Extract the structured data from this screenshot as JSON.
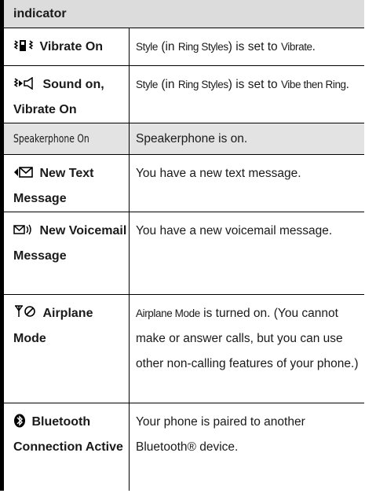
{
  "table": {
    "header": "indicator",
    "rows": [
      {
        "icon": "vibrate-icon",
        "icon_glyph": "⦚▮⦚",
        "title": "Vibrate On",
        "desc_parts": [
          {
            "t": "Style",
            "k": "c"
          },
          {
            "t": " (in ",
            "k": "n"
          },
          {
            "t": "Ring Styles",
            "k": "c"
          },
          {
            "t": ") is set to ",
            "k": "n"
          },
          {
            "t": "Vibrate",
            "k": "c"
          },
          {
            "t": ".",
            "k": "n"
          }
        ]
      },
      {
        "icon": "sound-vibrate-icon",
        "icon_glyph": "⦚▷◇",
        "title": "Sound on, Vibrate On",
        "desc_parts": [
          {
            "t": "Style",
            "k": "c"
          },
          {
            "t": " (in ",
            "k": "n"
          },
          {
            "t": "Ring Styles",
            "k": "c"
          },
          {
            "t": ") is set to ",
            "k": "n"
          },
          {
            "t": "Vibe then Ring",
            "k": "c"
          },
          {
            "t": ".",
            "k": "n"
          }
        ]
      },
      {
        "icon": "",
        "icon_glyph": "",
        "title": "Speakerphone On",
        "title_style": "small",
        "desc_parts": [
          {
            "t": "Speakerphone is on.",
            "k": "n"
          }
        ]
      },
      {
        "icon": "new-text-message-icon",
        "icon_glyph": "✉",
        "title": "New Text Message",
        "desc_parts": [
          {
            "t": "You have a new text message.",
            "k": "n"
          }
        ]
      },
      {
        "icon": "new-voicemail-icon",
        "icon_glyph": "✉))",
        "title": "New Voicemail Message",
        "desc_parts": [
          {
            "t": "You have a new voicemail message.",
            "k": "n"
          }
        ]
      },
      {
        "icon": "airplane-mode-icon",
        "icon_glyph": "Y⊘",
        "title": "Airplane Mode",
        "desc_parts": [
          {
            "t": "Airplane Mode",
            "k": "c"
          },
          {
            "t": " is turned on. (You cannot make or answer calls, but you can use other non-calling features of your phone.)",
            "k": "n"
          }
        ]
      },
      {
        "icon": "bluetooth-icon",
        "icon_glyph": "❸",
        "title": "Bluetooth Connection Active",
        "desc_parts": [
          {
            "t": "Your phone is paired to another Bluetooth® device.",
            "k": "n"
          }
        ]
      }
    ]
  }
}
